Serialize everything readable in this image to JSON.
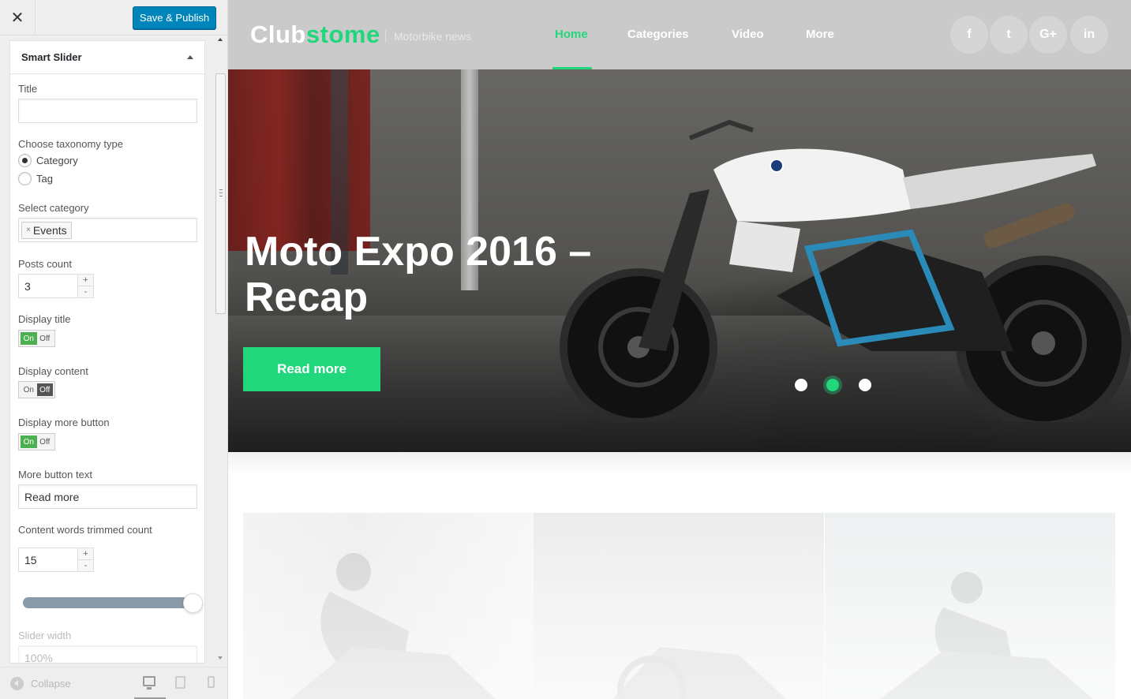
{
  "customizer": {
    "save_publish": "Save & Publish",
    "panel_title": "Smart Slider",
    "fields": {
      "title_label": "Title",
      "title_value": "",
      "taxonomy_label": "Choose taxonomy type",
      "taxonomy_options": [
        "Category",
        "Tag"
      ],
      "taxonomy_selected": "Category",
      "category_label": "Select category",
      "category_tag": "Events",
      "posts_count_label": "Posts count",
      "posts_count_value": "3",
      "display_title_label": "Display title",
      "display_title_on": true,
      "display_content_label": "Display content",
      "display_content_on": false,
      "display_more_label": "Display more button",
      "display_more_on": true,
      "toggle_on": "On",
      "toggle_off": "Off",
      "more_text_label": "More button text",
      "more_text_value": "Read more",
      "trim_label": "Content words trimmed count",
      "trim_value": "15",
      "slider_width_label": "Slider width",
      "slider_width_value": "100%"
    },
    "footer": {
      "collapse": "Collapse"
    }
  },
  "site": {
    "logo_part1": "Club",
    "logo_part2": "stome",
    "tagline": "Motorbike news",
    "nav": [
      "Home",
      "Categories",
      "Video",
      "More"
    ],
    "nav_active": "Home",
    "social": [
      "f",
      "t",
      "G+",
      "in"
    ],
    "hero": {
      "title": "Moto Expo 2016 – Recap",
      "button": "Read more",
      "slide_count": 3,
      "active_slide": 2
    },
    "accent_color": "#21d77b"
  }
}
